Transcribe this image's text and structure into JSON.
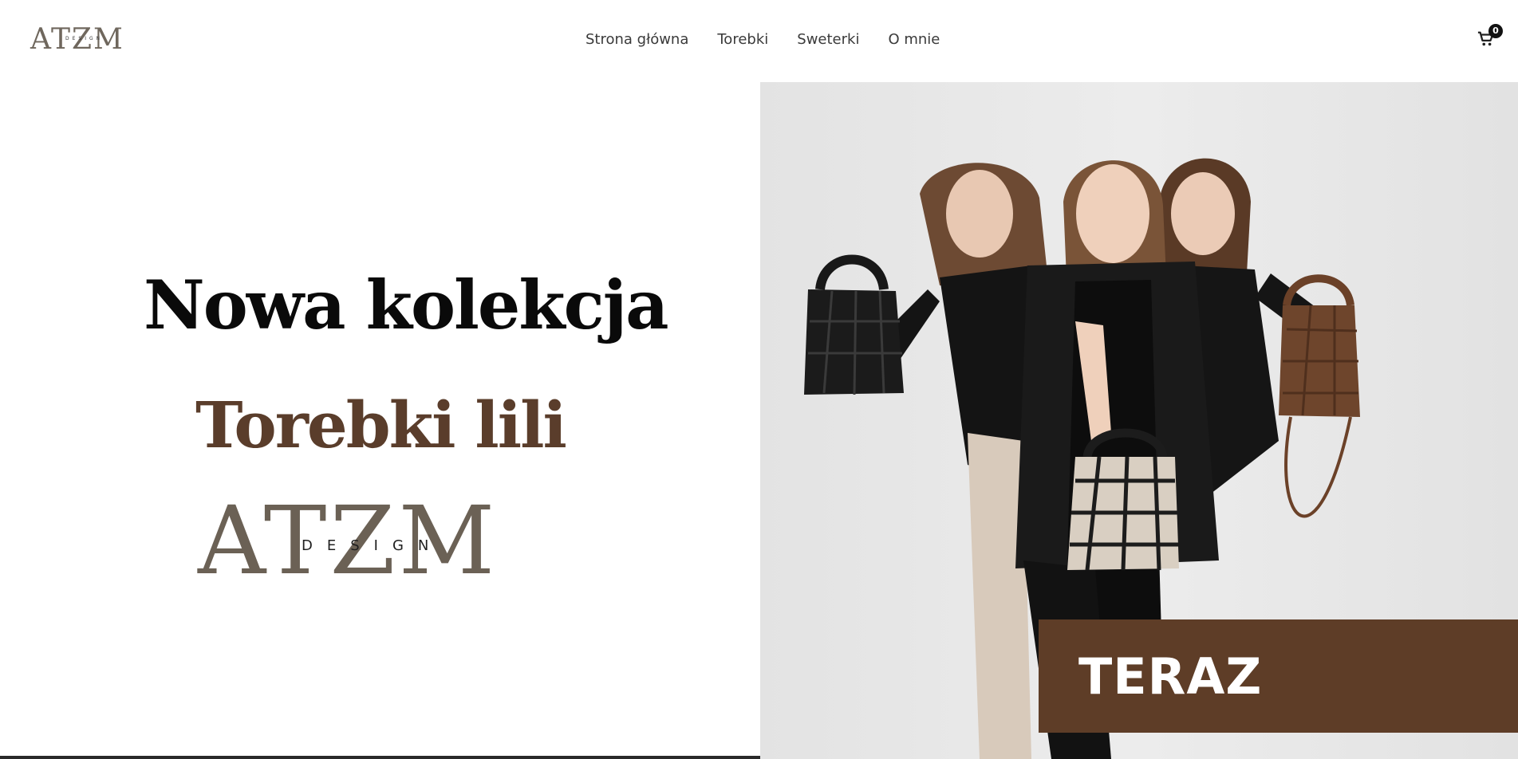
{
  "header": {
    "logo": {
      "letters": "ATZM",
      "small": "DESIGN"
    },
    "nav": [
      {
        "label": "Strona główna"
      },
      {
        "label": "Torebki"
      },
      {
        "label": "Sweterki"
      },
      {
        "label": "O mnie"
      }
    ],
    "cart": {
      "icon": "cart-icon",
      "count": "0"
    }
  },
  "hero": {
    "headline": "Nowa kolekcja",
    "subheadline": "Torebki lili",
    "brand": {
      "letters": "ATZM",
      "small": "DESIGN"
    },
    "cta_label": "TERAZ",
    "colors": {
      "accent_brown": "#5e3d27",
      "subheadline_brown": "#5a3d2b"
    }
  }
}
